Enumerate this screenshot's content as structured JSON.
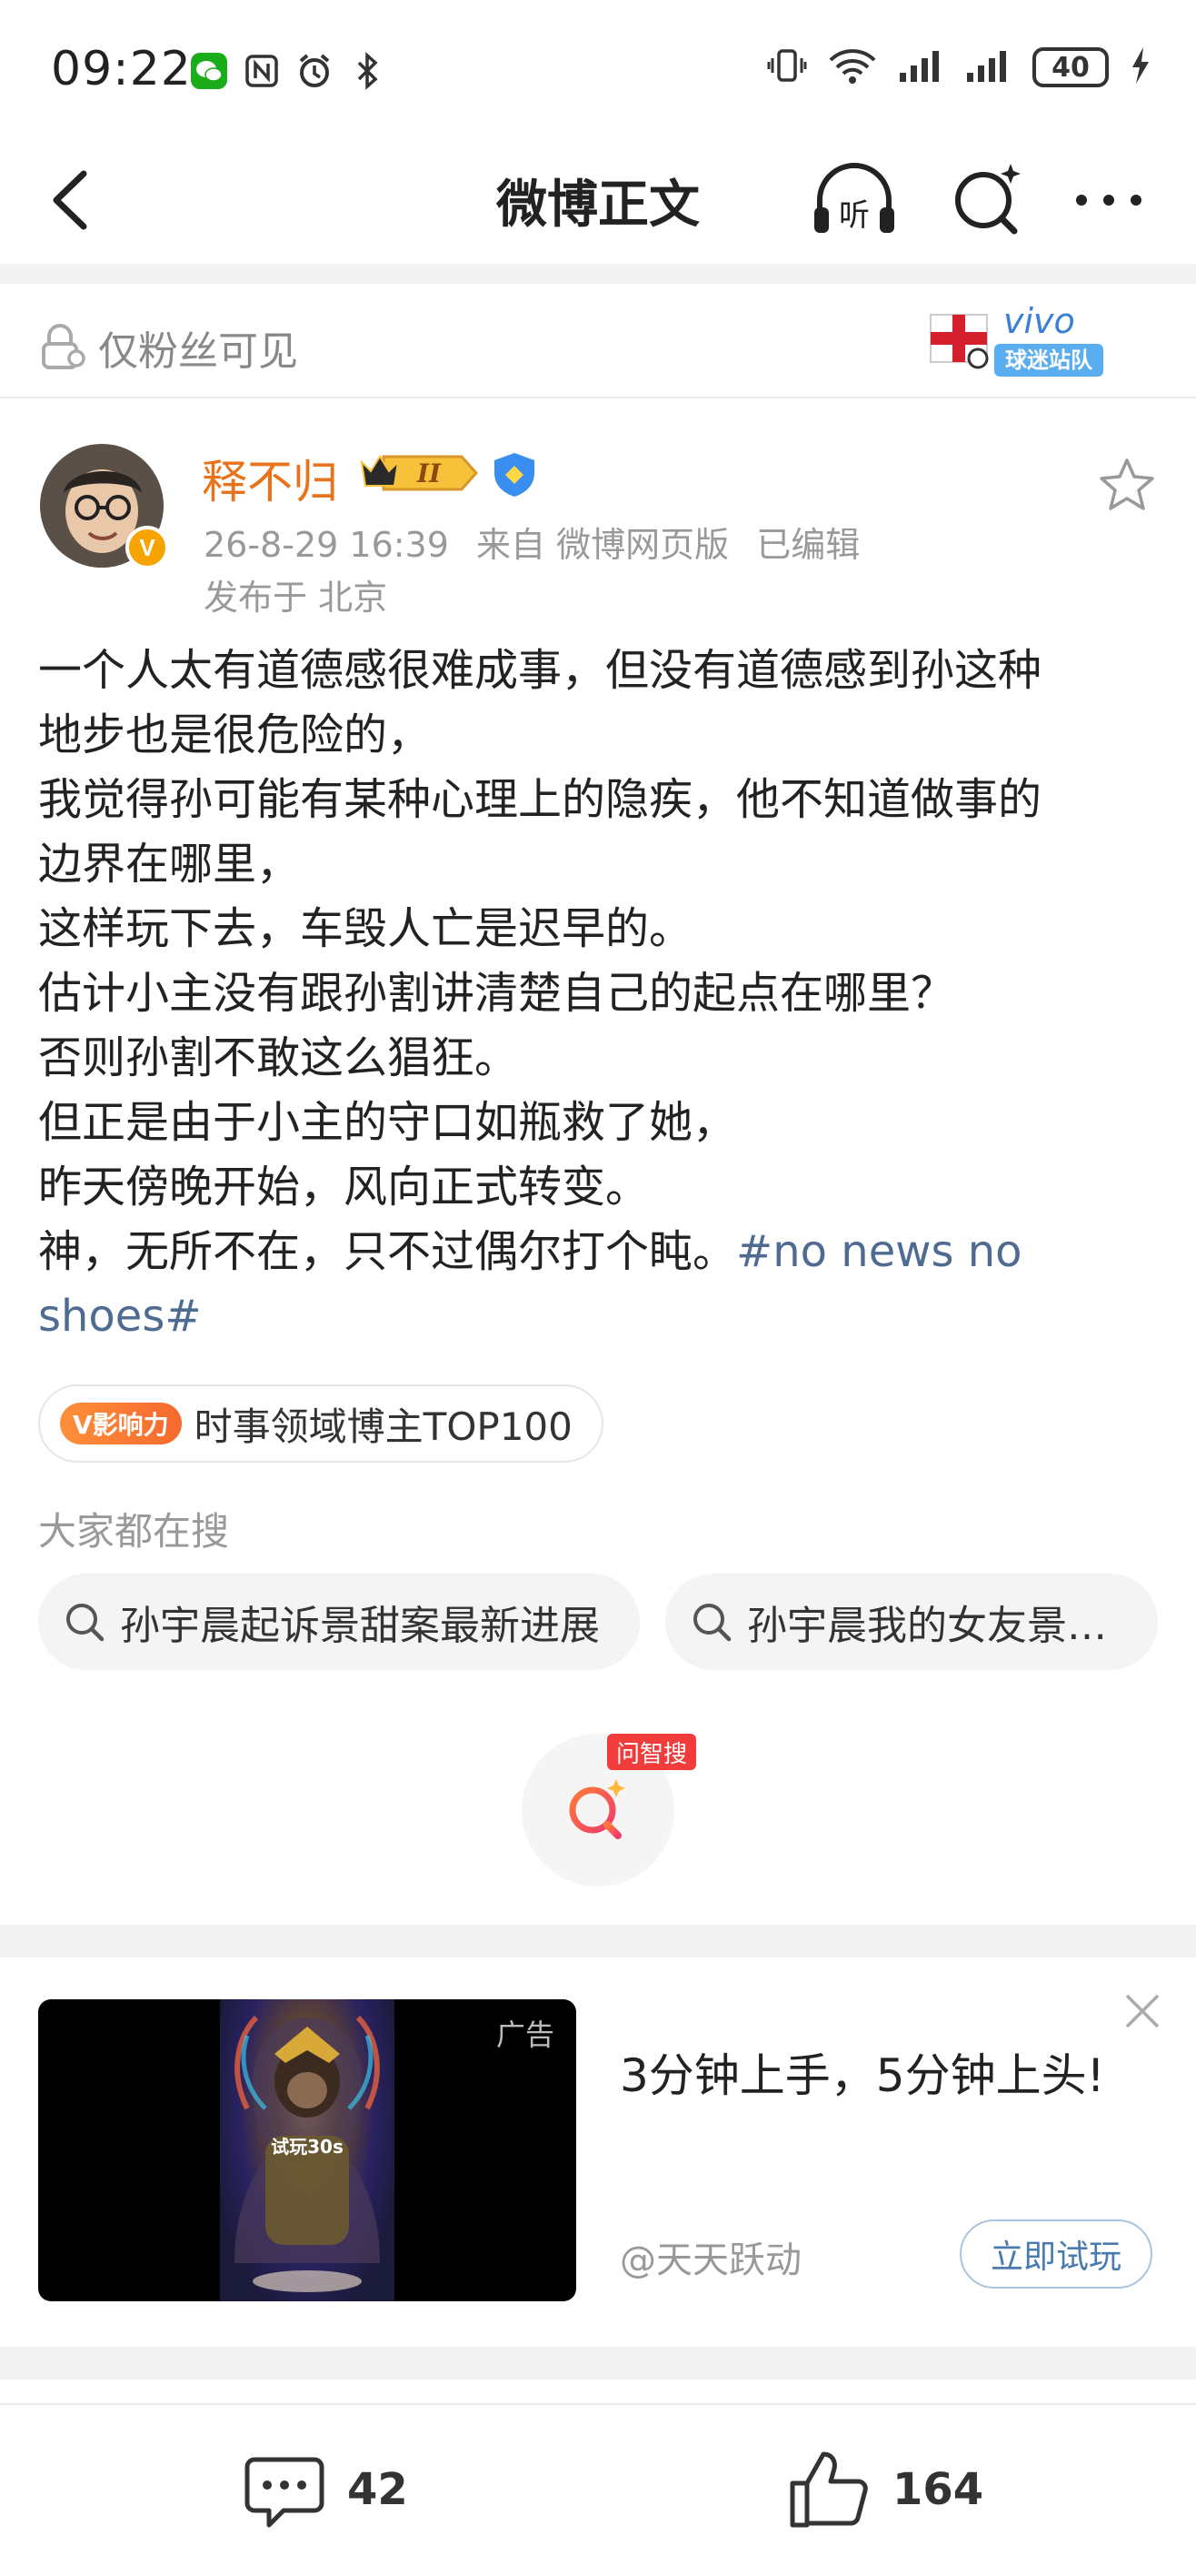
{
  "status_bar": {
    "time": "09:22",
    "battery": "40",
    "icons": [
      "wechat-icon",
      "nfc-icon",
      "alarm-icon",
      "bluetooth-icon",
      "vibrate-icon",
      "wifi-icon",
      "signal-icon",
      "signal-icon",
      "battery-icon",
      "charging-icon"
    ]
  },
  "navbar": {
    "title": "微博正文",
    "listen_label": "听"
  },
  "visibility": {
    "text": "仅粉丝可见",
    "badge_text_top": "vivo",
    "badge_text_bottom": "球迷站队"
  },
  "author": {
    "name": "释不归",
    "level": "II",
    "verified_badge": "V",
    "time": "26-8-29 16:39",
    "source": "来自 微博网页版",
    "edited": "已编辑",
    "location": "发布于 北京"
  },
  "post": {
    "lines": [
      "一个人太有道德感很难成事，但没有道德感到孙这种",
      "地步也是很危险的，",
      "我觉得孙可能有某种心理上的隐疾，他不知道做事的",
      "边界在哪里，",
      "这样玩下去，车毁人亡是迟早的。",
      "估计小主没有跟孙割讲清楚自己的起点在哪里？",
      "否则孙割不敢这么猖狂。",
      "但正是由于小主的守口如瓶救了她，",
      "昨天傍晚开始，风向正式转变。"
    ],
    "last_line_text": "神，无所不在，只不过偶尔打个盹。",
    "hashtag_part1": "#no news no",
    "hashtag_part2": "shoes#"
  },
  "influence": {
    "badge": "V影响力",
    "text": "时事领域博主TOP100"
  },
  "search": {
    "heading": "大家都在搜",
    "chips": [
      "孙宇晨起诉景甜案最新进展",
      "孙宇晨我的女友景…"
    ]
  },
  "ai_search": {
    "tag": "问智搜"
  },
  "ad": {
    "label": "广告",
    "image_caption": "试玩30s",
    "title": "3分钟上手，5分钟上头!",
    "source": "@天天跃动",
    "button": "立即试玩"
  },
  "bottom_bar": {
    "comments": "42",
    "likes": "164"
  },
  "colors": {
    "author_name": "#e8731a",
    "hashtag": "#4f6b91",
    "accent_orange": "#f5692f",
    "ai_tag": "#f23b3b"
  }
}
